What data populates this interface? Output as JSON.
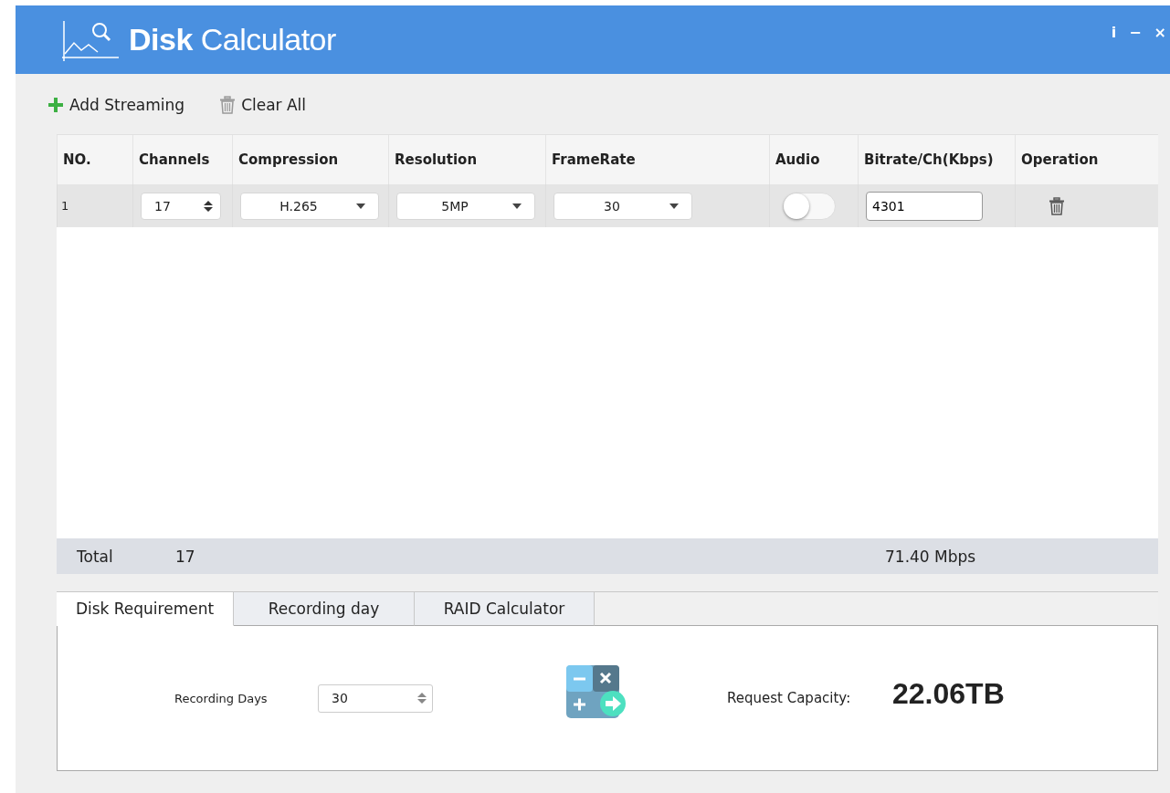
{
  "window": {
    "title": "**Disk** Calculator",
    "controls": [
      "i",
      "−",
      "×"
    ]
  },
  "toolbar": [
    {
      "label": "Add Streaming",
      "kind": "add"
    },
    {
      "label": "Clear All",
      "kind": "clear"
    }
  ],
  "table": {
    "columns": [
      "NO.",
      "Channels",
      "Compression",
      "Resolution",
      "FrameRate",
      "Audio",
      "Bitrate/Ch(Kbps)",
      "Operation"
    ],
    "rows": [
      {
        "no": "1",
        "channels": "17",
        "compression": "H.265",
        "resolution": "5MP",
        "frame_rate": "30",
        "audio": false,
        "bitrate": "4301"
      }
    ]
  },
  "totals": {
    "label": "Total",
    "channels": "17",
    "bitrate": "71.40 Mbps"
  },
  "tabs": [
    {
      "label": "Disk Requirement",
      "selected": true
    },
    {
      "label": "Recording day",
      "selected": false
    },
    {
      "label": "RAID Calculator",
      "selected": false
    }
  ],
  "panel": {
    "days_label": "Recording Days",
    "days": "30",
    "capacity_label": "Request Capacity:",
    "capacity": "22.06TB"
  }
}
